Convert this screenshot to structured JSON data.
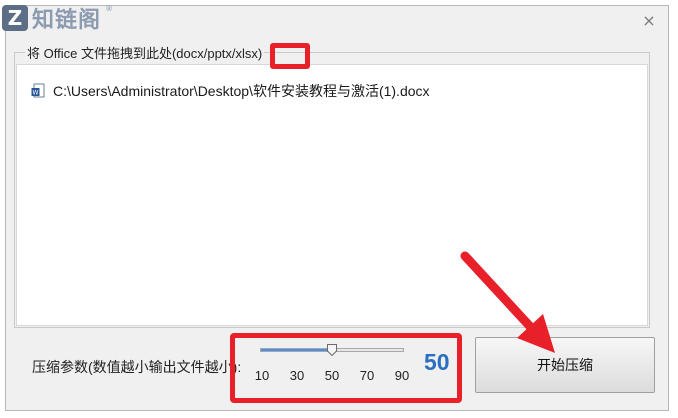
{
  "window": {
    "close_glyph": "×"
  },
  "logo": {
    "letter": "Z",
    "text": "知链阁",
    "reg": "®"
  },
  "group": {
    "title": "将 Office 文件拖拽到此处(docx/pptx/xlsx)"
  },
  "file_list": [
    {
      "path": "C:\\Users\\Administrator\\Desktop\\软件安装教程与激活(1).docx",
      "icon": "word-doc-icon"
    }
  ],
  "compression": {
    "label": "压缩参数(数值越小输出文件越小):",
    "value": 50,
    "min": 10,
    "max": 90,
    "ticks": [
      "10",
      "30",
      "50",
      "70",
      "90"
    ],
    "value_text": "50"
  },
  "start_button": {
    "label": "开始压缩"
  },
  "colors": {
    "highlight": "#e8202a",
    "value_blue": "#2a6fc0",
    "slider_fill": "#4a90e2"
  }
}
